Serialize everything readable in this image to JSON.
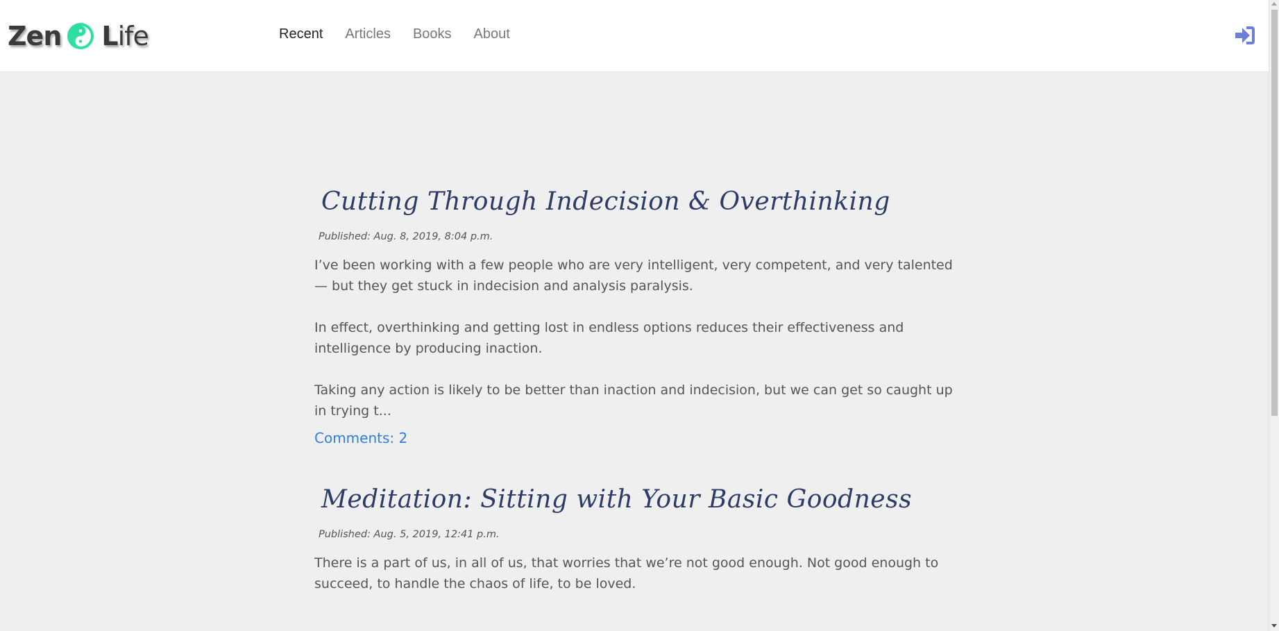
{
  "header": {
    "logo_text_left": "Zen",
    "logo_text_right_initial": "L",
    "logo_text_right_rest": "ife",
    "logo_icon": "yin-yang-icon",
    "nav": [
      {
        "label": "Recent",
        "active": true
      },
      {
        "label": "Articles",
        "active": false
      },
      {
        "label": "Books",
        "active": false
      },
      {
        "label": "About",
        "active": false
      }
    ],
    "signin_icon": "sign-in-icon"
  },
  "posts": [
    {
      "title": "Cutting Through Indecision & Overthinking",
      "published": "Published: Aug. 8, 2019, 8:04 p.m.",
      "paragraphs": [
        "I’ve been working with a few people who are very intelligent, very competent, and very talented — but they get stuck in indecision and analysis paralysis.",
        "In effect, overthinking and getting lost in endless options reduces their effectiveness and intelligence by producing inaction.",
        "Taking any action is likely to be better than inaction and indecision, but we can get so caught up in trying t..."
      ],
      "comments": "Comments: 2"
    },
    {
      "title": "Meditation: Sitting with Your Basic Goodness",
      "published": "Published: Aug. 5, 2019, 12:41 p.m.",
      "paragraphs": [
        "There is a part of us, in all of us, that worries that we’re not good enough. Not good enough to succeed, to handle the chaos of life, to be loved."
      ]
    }
  ],
  "colors": {
    "accent": "#2d7fe0",
    "title": "#2c3c66",
    "logo_icon": "#2ee0a0",
    "signin": "#6d7fd6"
  }
}
